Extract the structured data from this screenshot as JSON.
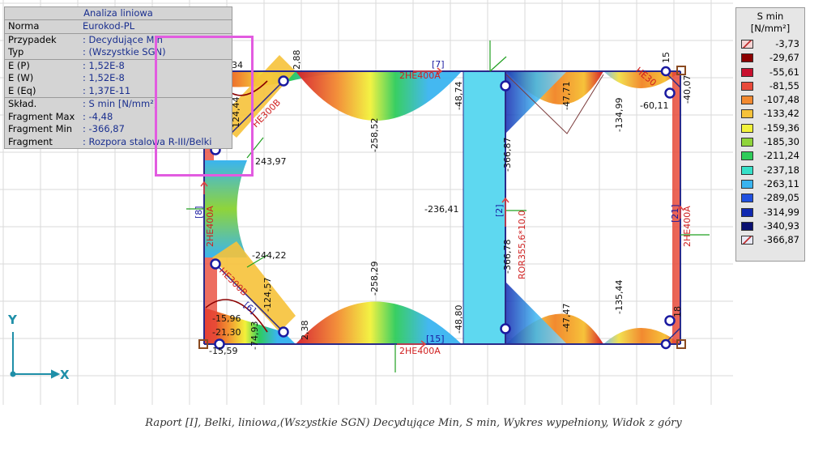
{
  "info": {
    "title": "Analiza liniowa",
    "rows": [
      {
        "key": "Norma",
        "value": "Eurokod-PL"
      },
      {
        "key": "Przypadek",
        "value": ": Decydujące Min"
      },
      {
        "key": "Typ",
        "value": ": (Wszystkie SGN)"
      },
      {
        "key": "E (P)",
        "value": ": 1,52E-8"
      },
      {
        "key": "E (W)",
        "value": ": 1,52E-8"
      },
      {
        "key": "E (Eq)",
        "value": ": 1,37E-11"
      },
      {
        "key": "Skład.",
        "value": ": S min [N/mm²]"
      },
      {
        "key": "Fragment Max",
        "value": ": -4,48"
      },
      {
        "key": "Fragment Min",
        "value": ": -366,87"
      },
      {
        "key": "Fragment",
        "value": ": Rozpora stalowa R-III/Belki"
      }
    ]
  },
  "legend": {
    "title": "S min",
    "unit": "[N/mm²]",
    "entries": [
      {
        "value": "-3,73",
        "color": "#f4d4d4"
      },
      {
        "value": "-29,67",
        "color": "#8b0000"
      },
      {
        "value": "-55,61",
        "color": "#c8102e"
      },
      {
        "value": "-81,55",
        "color": "#e84a3a"
      },
      {
        "value": "-107,48",
        "color": "#f28a30"
      },
      {
        "value": "-133,42",
        "color": "#f6c23a"
      },
      {
        "value": "-159,36",
        "color": "#f2f23a"
      },
      {
        "value": "-185,30",
        "color": "#8fd43a"
      },
      {
        "value": "-211,24",
        "color": "#2ecc5a"
      },
      {
        "value": "-237,18",
        "color": "#36e0c8"
      },
      {
        "value": "-263,11",
        "color": "#3ab4f0"
      },
      {
        "value": "-289,05",
        "color": "#2050e0"
      },
      {
        "value": "-314,99",
        "color": "#1028b0"
      },
      {
        "value": "-340,93",
        "color": "#0a1070"
      },
      {
        "value": "-366,87",
        "color": "#e8e8f4"
      }
    ]
  },
  "labels": {
    "v_2_88": "2,88",
    "v_2_38": "2,38",
    "v_124_44": "124,44",
    "v_243_97": "243,97",
    "v_244_22": "-244,22",
    "v_124_57": "-124,57",
    "v_15_96": "-15,96",
    "v_21_30": "-21,30",
    "v_15_59": "-15,59",
    "v_74_93": "-74,93",
    "v_258_52": "-258,52",
    "v_258_29": "-258,29",
    "v_236_41": "-236,41",
    "v_48_74": "-48,74",
    "v_48_80": "-48,80",
    "v_366_87_a": "-366,87",
    "v_366_78": "-366,78",
    "v_47_71": "-47,71",
    "v_47_47": "-47,47",
    "v_134_99": "-134,99",
    "v_135_44": "-135,44",
    "v_60_11": "-60,11",
    "v_40_07": "-40,07",
    "v_15": "15",
    "v_34": "34",
    "v_18": "18",
    "bar_7": "[7]",
    "bar_15": "[15]",
    "bar_8": "[8]",
    "bar_2": "[2]",
    "bar_21": "[21]",
    "bar_6": "[6]",
    "sec_top": "2HE400A",
    "sec_bottom": "2HE400A",
    "sec_left": "2HE400A",
    "sec_right": "2HE400A",
    "sec_strut": "ROR355,6*10,0",
    "sec_he300_a": "HE300B",
    "sec_he300_b": "HE300B",
    "sec_he300_c": "HE30"
  },
  "axes": {
    "y": "Y",
    "x": "X"
  },
  "caption": "Raport [I], Belki, liniowa,(Wszystkie SGN) Decydujące Min, S min, Wykres wypełniony, Widok z góry"
}
